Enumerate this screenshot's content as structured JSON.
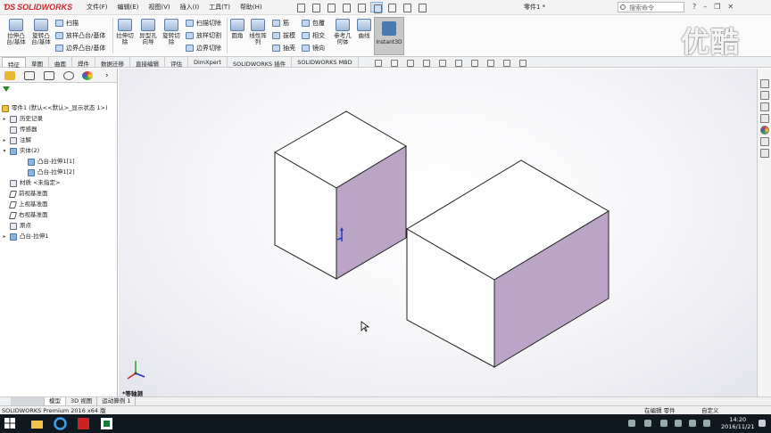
{
  "app": {
    "logo_text": "SOLIDWORKS",
    "menus": [
      "文件(F)",
      "编辑(E)",
      "视图(V)",
      "插入(I)",
      "工具(T)",
      "帮助(H)"
    ],
    "document_title": "零件1 *",
    "search_placeholder": "搜索命令"
  },
  "ribbon": {
    "big_buttons": [
      "拉伸凸台/基体",
      "旋转凸台/基体",
      "拉伸切除",
      "异型孔向导",
      "旋转切除",
      "圆角",
      "线性阵列",
      "参考几何体",
      "曲线"
    ],
    "small_buttons": [
      "扫描",
      "放样凸台/基体",
      "边界凸台/基体",
      "扫描切除",
      "放样切割",
      "边界切除",
      "筋",
      "拔模",
      "抽壳",
      "包覆",
      "相交",
      "镜向"
    ],
    "instant3d_label": "Instant3D"
  },
  "tabs": [
    "特征",
    "草图",
    "曲面",
    "焊件",
    "数据迁移",
    "直接编辑",
    "评估",
    "DimXpert",
    "SOLIDWORKS 插件",
    "SOLIDWORKS MBD"
  ],
  "active_tab": "特征",
  "tree": {
    "root": "零件1 (默认<<默认>_显示状态 1>)",
    "items": [
      {
        "label": "历史记录",
        "icon": "history-icon",
        "twisty": "▸"
      },
      {
        "label": "传感器",
        "icon": "sensor-icon",
        "twisty": ""
      },
      {
        "label": "注解",
        "icon": "annotation-icon",
        "twisty": "▸"
      },
      {
        "label": "实体(2)",
        "icon": "solid-bodies-icon",
        "twisty": "▾"
      },
      {
        "label": "凸台-拉伸1[1]",
        "icon": "body-icon",
        "twisty": ""
      },
      {
        "label": "凸台-拉伸1[2]",
        "icon": "body-icon",
        "twisty": ""
      },
      {
        "label": "材质 <未指定>",
        "icon": "material-icon",
        "twisty": ""
      },
      {
        "label": "前视基准面",
        "icon": "plane-icon",
        "twisty": ""
      },
      {
        "label": "上视基准面",
        "icon": "plane-icon",
        "twisty": ""
      },
      {
        "label": "右视基准面",
        "icon": "plane-icon",
        "twisty": ""
      },
      {
        "label": "原点",
        "icon": "origin-icon",
        "twisty": ""
      },
      {
        "label": "凸台-拉伸1",
        "icon": "extrude-icon",
        "twisty": "▸"
      }
    ]
  },
  "viewport": {
    "view_label": "*等轴测",
    "colors": {
      "top_face": "#ffffff",
      "front_face": "#ffffff",
      "side_face": "#bba5c7",
      "edge": "#222222",
      "origin": "#2a3ab8"
    }
  },
  "model_tabs": [
    "模型",
    "3D 视图",
    "运动算例 1"
  ],
  "active_model_tab": "模型",
  "status": {
    "product": "SOLIDWORKS Premium 2016 x64 版",
    "editing": "在编辑 零件",
    "units": "自定义"
  },
  "taskbar": {
    "time": "14:20",
    "date": "2016/11/21"
  },
  "watermark": "优酷"
}
